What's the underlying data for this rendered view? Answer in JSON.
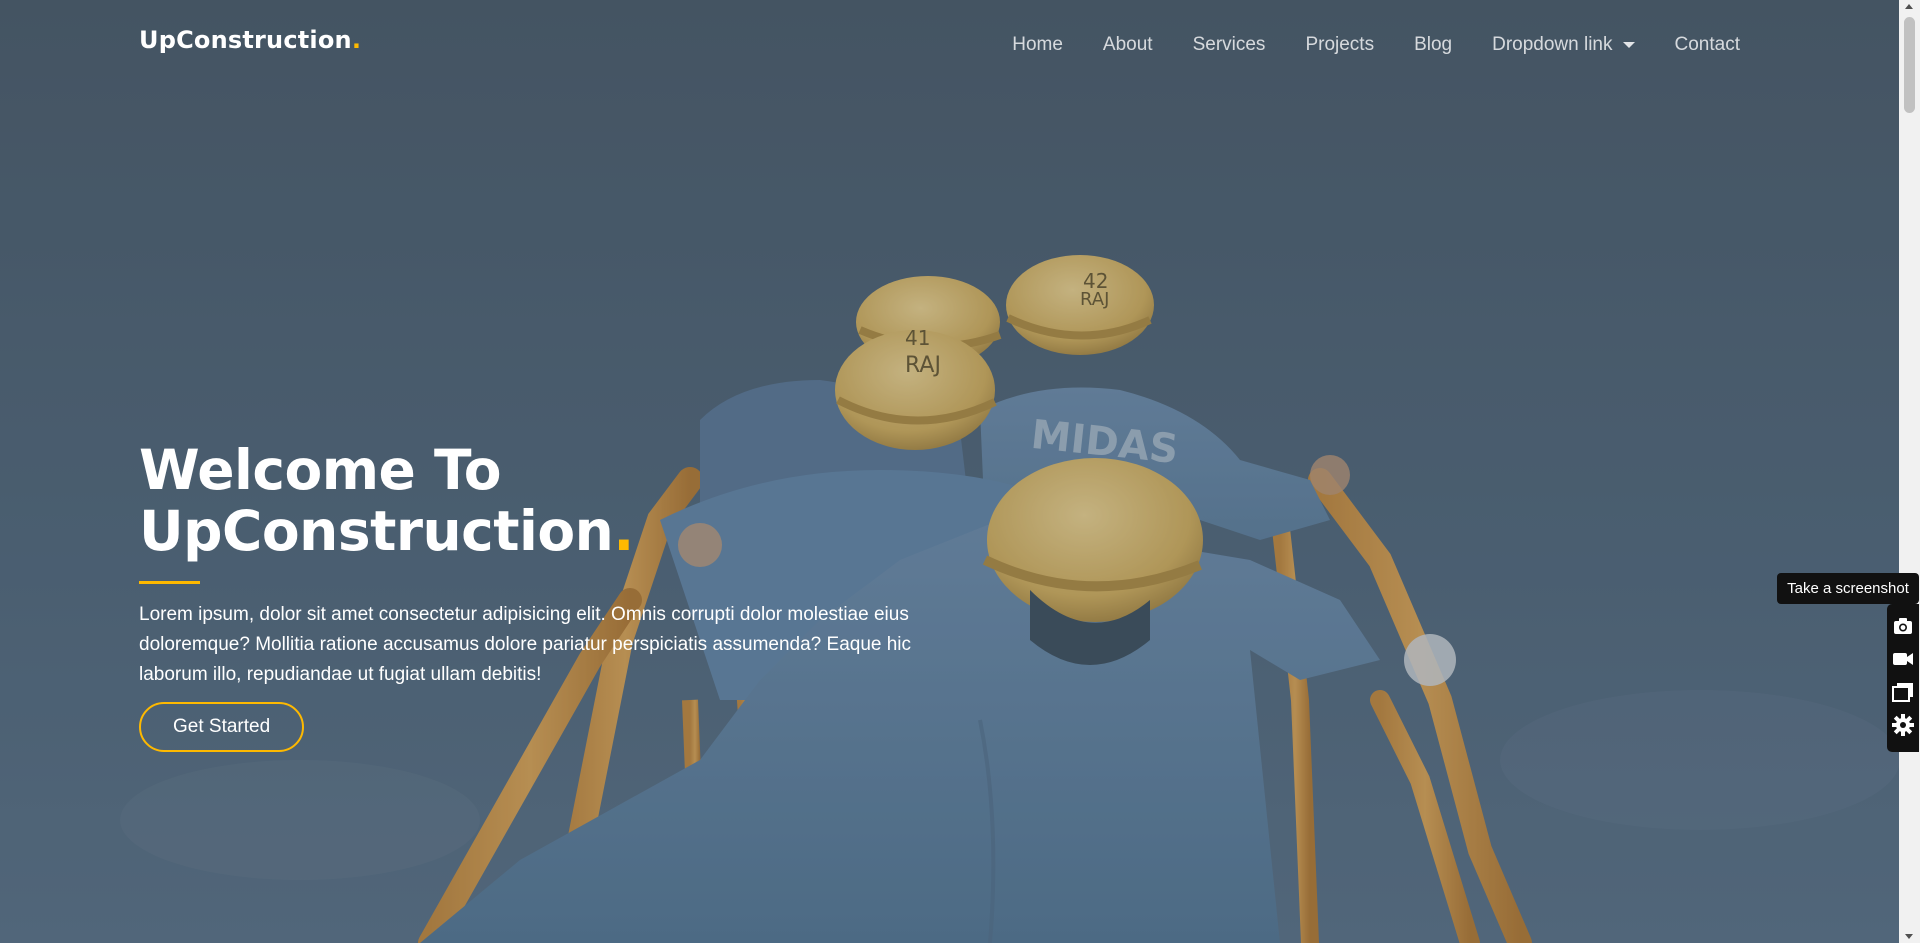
{
  "navbar": {
    "brand": "UpConstruction",
    "brand_dot": ".",
    "links": [
      {
        "label": "Home"
      },
      {
        "label": "About"
      },
      {
        "label": "Services"
      },
      {
        "label": "Projects"
      },
      {
        "label": "Blog"
      },
      {
        "label": "Dropdown link",
        "has_caret": true
      },
      {
        "label": "Contact"
      }
    ]
  },
  "hero": {
    "title": "Welcome To UpConstruction",
    "title_dot": ".",
    "text": "Lorem ipsum, dolor sit amet consectetur adipisicing elit. Omnis corrupti dolor molestiae eius doloremque? Mollitia ratione accusamus dolore pariatur perspiciatis assumenda? Eaque hic laborum illo, repudiandae ut fugiat ullam debitis!",
    "cta_label": "Get Started",
    "photo_icon": "construction-workers-photo"
  },
  "screenshot_tool": {
    "tooltip": "Take a screenshot",
    "tools": [
      {
        "icon": "camera-icon"
      },
      {
        "icon": "video-camera-icon"
      },
      {
        "icon": "windows-icon"
      },
      {
        "icon": "gear-icon"
      }
    ]
  },
  "colors": {
    "accent": "#feb900",
    "hero_overlay": "#4c6477",
    "tooltip_bg": "#111111"
  }
}
